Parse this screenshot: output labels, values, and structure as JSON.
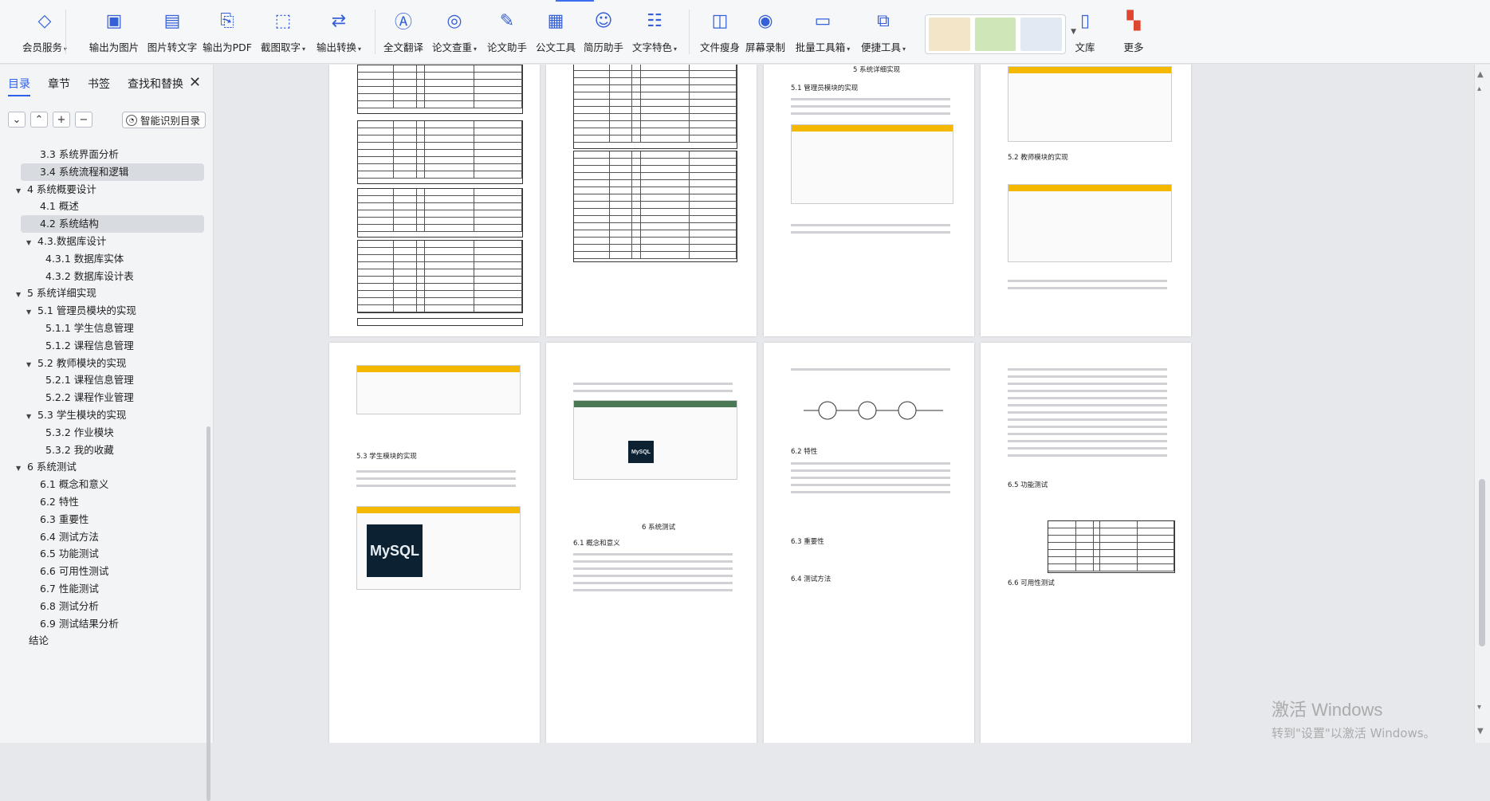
{
  "ribbon": {
    "buttons": [
      {
        "label": "会员服务",
        "dropdown": true,
        "icon": "member-diamond-icon"
      },
      {
        "label": "输出为图片",
        "dropdown": false,
        "icon": "export-image-icon"
      },
      {
        "label": "图片转文字",
        "dropdown": false,
        "icon": "image-to-text-icon"
      },
      {
        "label": "输出为PDF",
        "dropdown": false,
        "icon": "export-pdf-icon"
      },
      {
        "label": "截图取字",
        "dropdown": true,
        "icon": "screenshot-ocr-icon"
      },
      {
        "label": "输出转换",
        "dropdown": true,
        "icon": "output-convert-icon"
      },
      {
        "label": "全文翻译",
        "dropdown": false,
        "icon": "translate-icon"
      },
      {
        "label": "论文查重",
        "dropdown": true,
        "icon": "plagiarism-check-icon"
      },
      {
        "label": "论文助手",
        "dropdown": false,
        "icon": "paper-assistant-icon"
      },
      {
        "label": "公文工具",
        "dropdown": false,
        "icon": "official-doc-icon"
      },
      {
        "label": "简历助手",
        "dropdown": false,
        "icon": "resume-icon"
      },
      {
        "label": "文字特色",
        "dropdown": true,
        "icon": "text-feature-icon"
      },
      {
        "label": "文件瘦身",
        "dropdown": false,
        "icon": "file-slim-icon"
      },
      {
        "label": "屏幕录制",
        "dropdown": false,
        "icon": "screen-record-icon"
      },
      {
        "label": "批量工具箱",
        "dropdown": true,
        "icon": "batch-toolbox-icon"
      },
      {
        "label": "便捷工具",
        "dropdown": true,
        "icon": "handy-tools-icon"
      },
      {
        "label": "文库",
        "dropdown": false,
        "icon": "library-icon"
      },
      {
        "label": "更多",
        "dropdown": false,
        "icon": "more-apps-icon"
      }
    ]
  },
  "sidebar": {
    "tabs": [
      "目录",
      "章节",
      "书签",
      "查找和替换"
    ],
    "active_tab": 0,
    "close_glyph": "✕",
    "smart_button": "智能识别目录",
    "toc": [
      {
        "text": "3.3 系统界面分析",
        "level": 2,
        "arrow": ""
      },
      {
        "text": "3.4 系统流程和逻辑",
        "level": 2,
        "arrow": "",
        "selected": true
      },
      {
        "text": "4 系统概要设计",
        "level": 1,
        "arrow": "▼"
      },
      {
        "text": "4.1 概述",
        "level": 2,
        "arrow": ""
      },
      {
        "text": "4.2 系统结构",
        "level": 2,
        "arrow": "",
        "selected": true
      },
      {
        "text": "4.3.数据库设计",
        "level": 2,
        "arrow": "▼"
      },
      {
        "text": "4.3.1 数据库实体",
        "level": 3,
        "arrow": ""
      },
      {
        "text": "4.3.2 数据库设计表",
        "level": 3,
        "arrow": ""
      },
      {
        "text": "5 系统详细实现",
        "level": 1,
        "arrow": "▼"
      },
      {
        "text": "5.1  管理员模块的实现",
        "level": 2,
        "arrow": "▼"
      },
      {
        "text": "5.1.1  学生信息管理",
        "level": 3,
        "arrow": ""
      },
      {
        "text": "5.1.2  课程信息管理",
        "level": 3,
        "arrow": ""
      },
      {
        "text": "5.2  教师模块的实现",
        "level": 2,
        "arrow": "▼"
      },
      {
        "text": "5.2.1  课程信息管理",
        "level": 3,
        "arrow": ""
      },
      {
        "text": "5.2.2  课程作业管理",
        "level": 3,
        "arrow": ""
      },
      {
        "text": "5.3  学生模块的实现",
        "level": 2,
        "arrow": "▼"
      },
      {
        "text": "5.3.2  作业模块",
        "level": 3,
        "arrow": ""
      },
      {
        "text": "5.3.2  我的收藏",
        "level": 3,
        "arrow": ""
      },
      {
        "text": "6 系统测试",
        "level": 1,
        "arrow": "▼"
      },
      {
        "text": "6.1 概念和意义",
        "level": 2,
        "arrow": ""
      },
      {
        "text": "6.2 特性",
        "level": 2,
        "arrow": ""
      },
      {
        "text": "6.3 重要性",
        "level": 2,
        "arrow": ""
      },
      {
        "text": "6.4 测试方法",
        "level": 2,
        "arrow": ""
      },
      {
        "text": "6.5  功能测试",
        "level": 2,
        "arrow": ""
      },
      {
        "text": "6.6 可用性测试",
        "level": 2,
        "arrow": ""
      },
      {
        "text": "6.7 性能测试",
        "level": 2,
        "arrow": ""
      },
      {
        "text": "6.8 测试分析",
        "level": 2,
        "arrow": ""
      },
      {
        "text": "6.9 测试结果分析",
        "level": 2,
        "arrow": ""
      },
      {
        "text": "结论",
        "level": 0,
        "arrow": ""
      }
    ]
  },
  "pages": {
    "p3_heading": "5 系统详细实现",
    "p3_sub": "5.1  管理员模块的实现",
    "p4_sub": "5.2  教师模块的实现",
    "p6_heading": "6 系统测试",
    "p6_sub": "6.1 概念和意义",
    "p7_sub1": "6.2 特性",
    "p7_sub2": "6.3 重要性",
    "p7_sub3": "6.4 测试方法",
    "p8_sub": "6.5 功能测试",
    "p8_sub2": "6.6 可用性测试",
    "p5_sub": "5.3  学生模块的实现",
    "mysql_text": "MySQL"
  },
  "watermark": {
    "line1": "激活 Windows",
    "line2": "转到\"设置\"以激活 Windows。"
  },
  "colors": {
    "accent": "#2f5fe8",
    "shot_header": "#f5b800"
  }
}
